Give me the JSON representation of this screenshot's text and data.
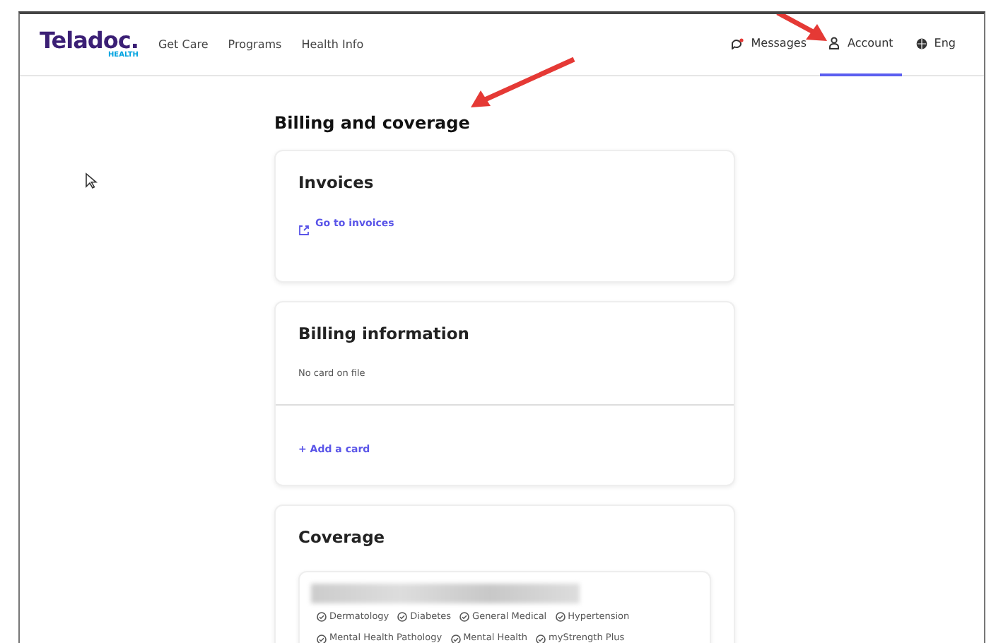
{
  "header": {
    "logo": "Teladoc.",
    "logo_sub": "HEALTH",
    "nav_links": [
      {
        "label": "Get Care"
      },
      {
        "label": "Programs"
      },
      {
        "label": "Health Info"
      }
    ],
    "right_tabs": [
      {
        "label": "Messages",
        "kind": "messages",
        "selected": false
      },
      {
        "label": "Account",
        "kind": "account",
        "selected": true
      },
      {
        "label": "Eng",
        "kind": "language",
        "selected": false
      }
    ]
  },
  "page_title": "Billing and coverage",
  "invoices": {
    "title": "Invoices",
    "link": "Go to invoices"
  },
  "billing": {
    "title": "Billing information",
    "status": "No card on file",
    "action": "+ Add a card"
  },
  "coverage": {
    "title": "Coverage",
    "services": [
      "Dermatology",
      "Diabetes",
      "General Medical",
      "Hypertension",
      "Mental Health Pathology",
      "Mental Health",
      "myStrength Plus"
    ]
  }
}
